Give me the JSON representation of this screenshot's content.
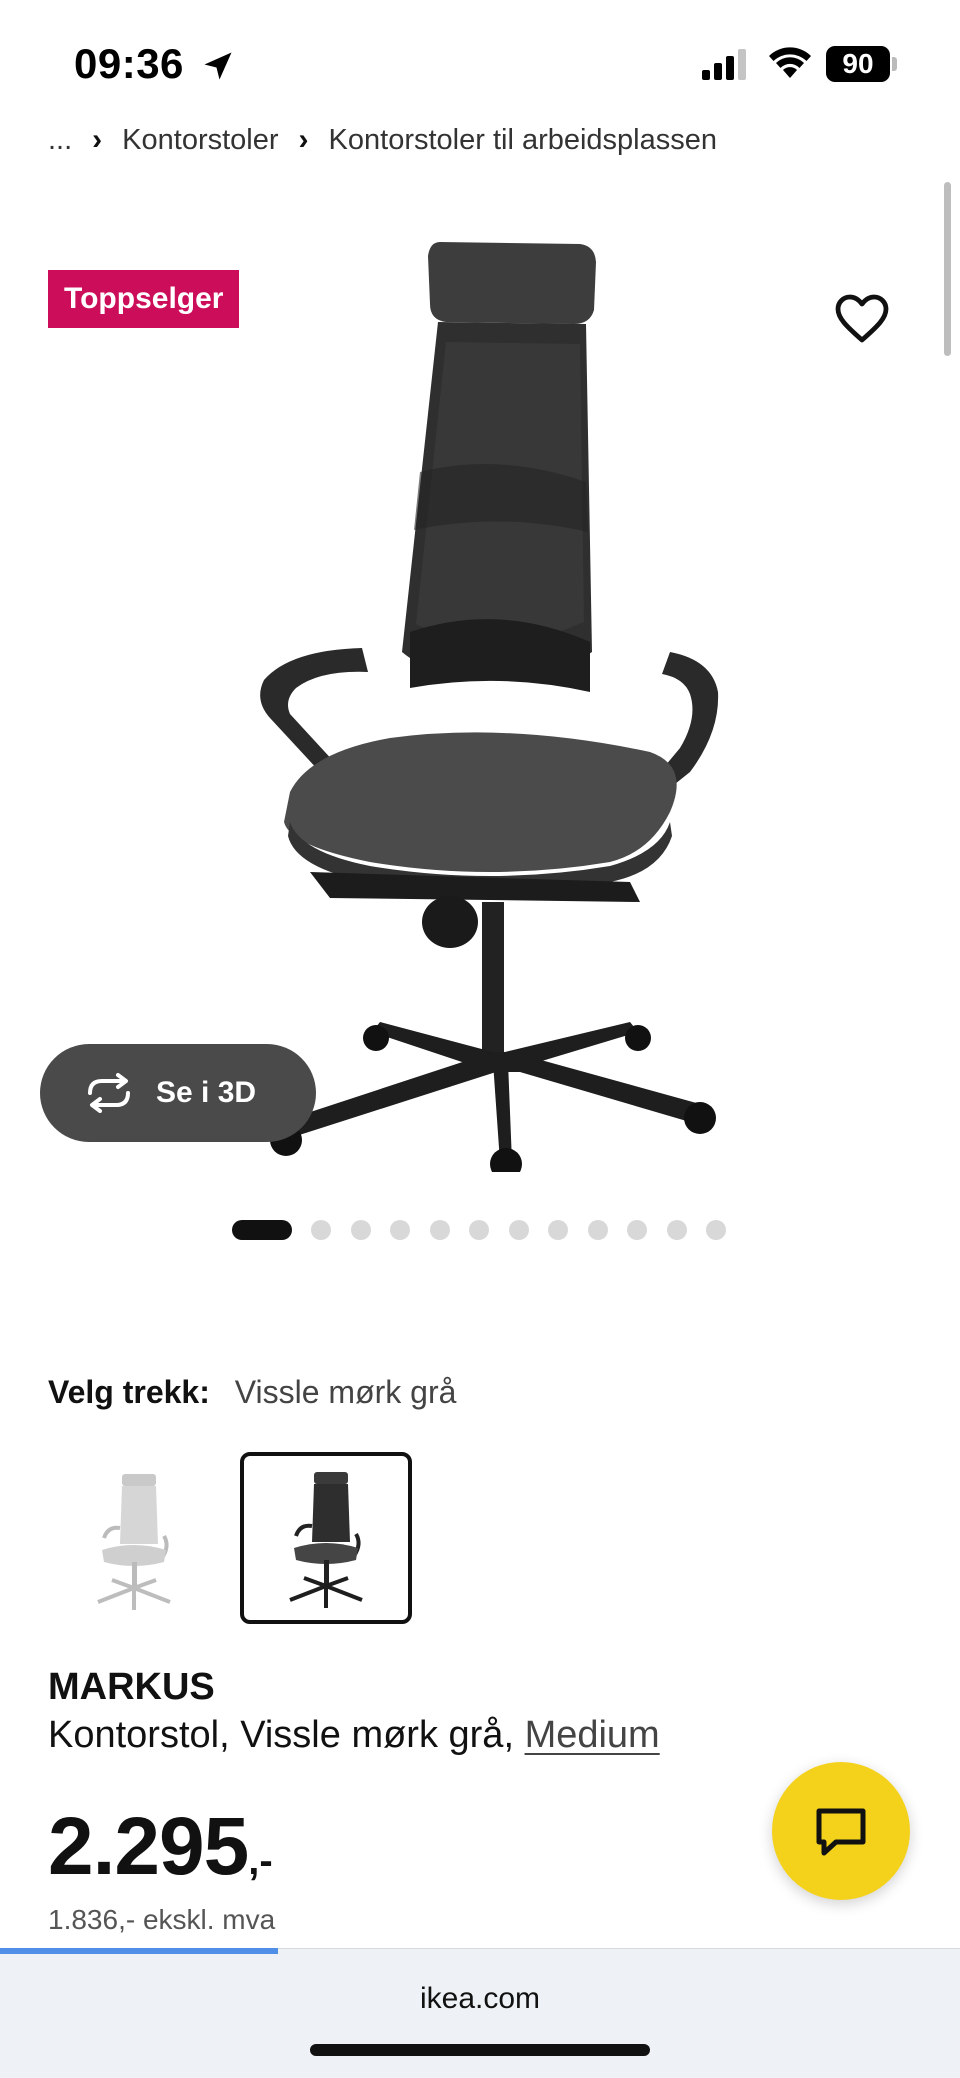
{
  "status_bar": {
    "time": "09:36",
    "battery": "90"
  },
  "breadcrumb": {
    "ellipsis": "...",
    "items": [
      "Kontorstoler",
      "Kontorstoler til arbeidsplassen"
    ]
  },
  "product": {
    "badge": "Toppselger",
    "see_3d": "Se i 3D",
    "gallery_count": 12,
    "gallery_active": 1,
    "variant_label": "Velg trekk:",
    "variant_value": "Vissle mørk grå",
    "name": "MARKUS",
    "description": "Kontorstol, Vissle mørk grå, ",
    "size_link": "Medium",
    "price_main": "2.295",
    "price_suffix": ",-",
    "price_ex_vat": "1.836,- ekskl. mva"
  },
  "browser": {
    "url": "ikea.com",
    "load_progress": 0.29
  },
  "colors": {
    "badge": "#cc0e5a",
    "chat_button": "#f4d21c",
    "progress": "#4f8fe8"
  },
  "icons": [
    "location-arrow-icon",
    "signal-icon",
    "wifi-icon",
    "battery-icon",
    "heart-icon",
    "rotate-3d-icon",
    "chat-icon"
  ]
}
